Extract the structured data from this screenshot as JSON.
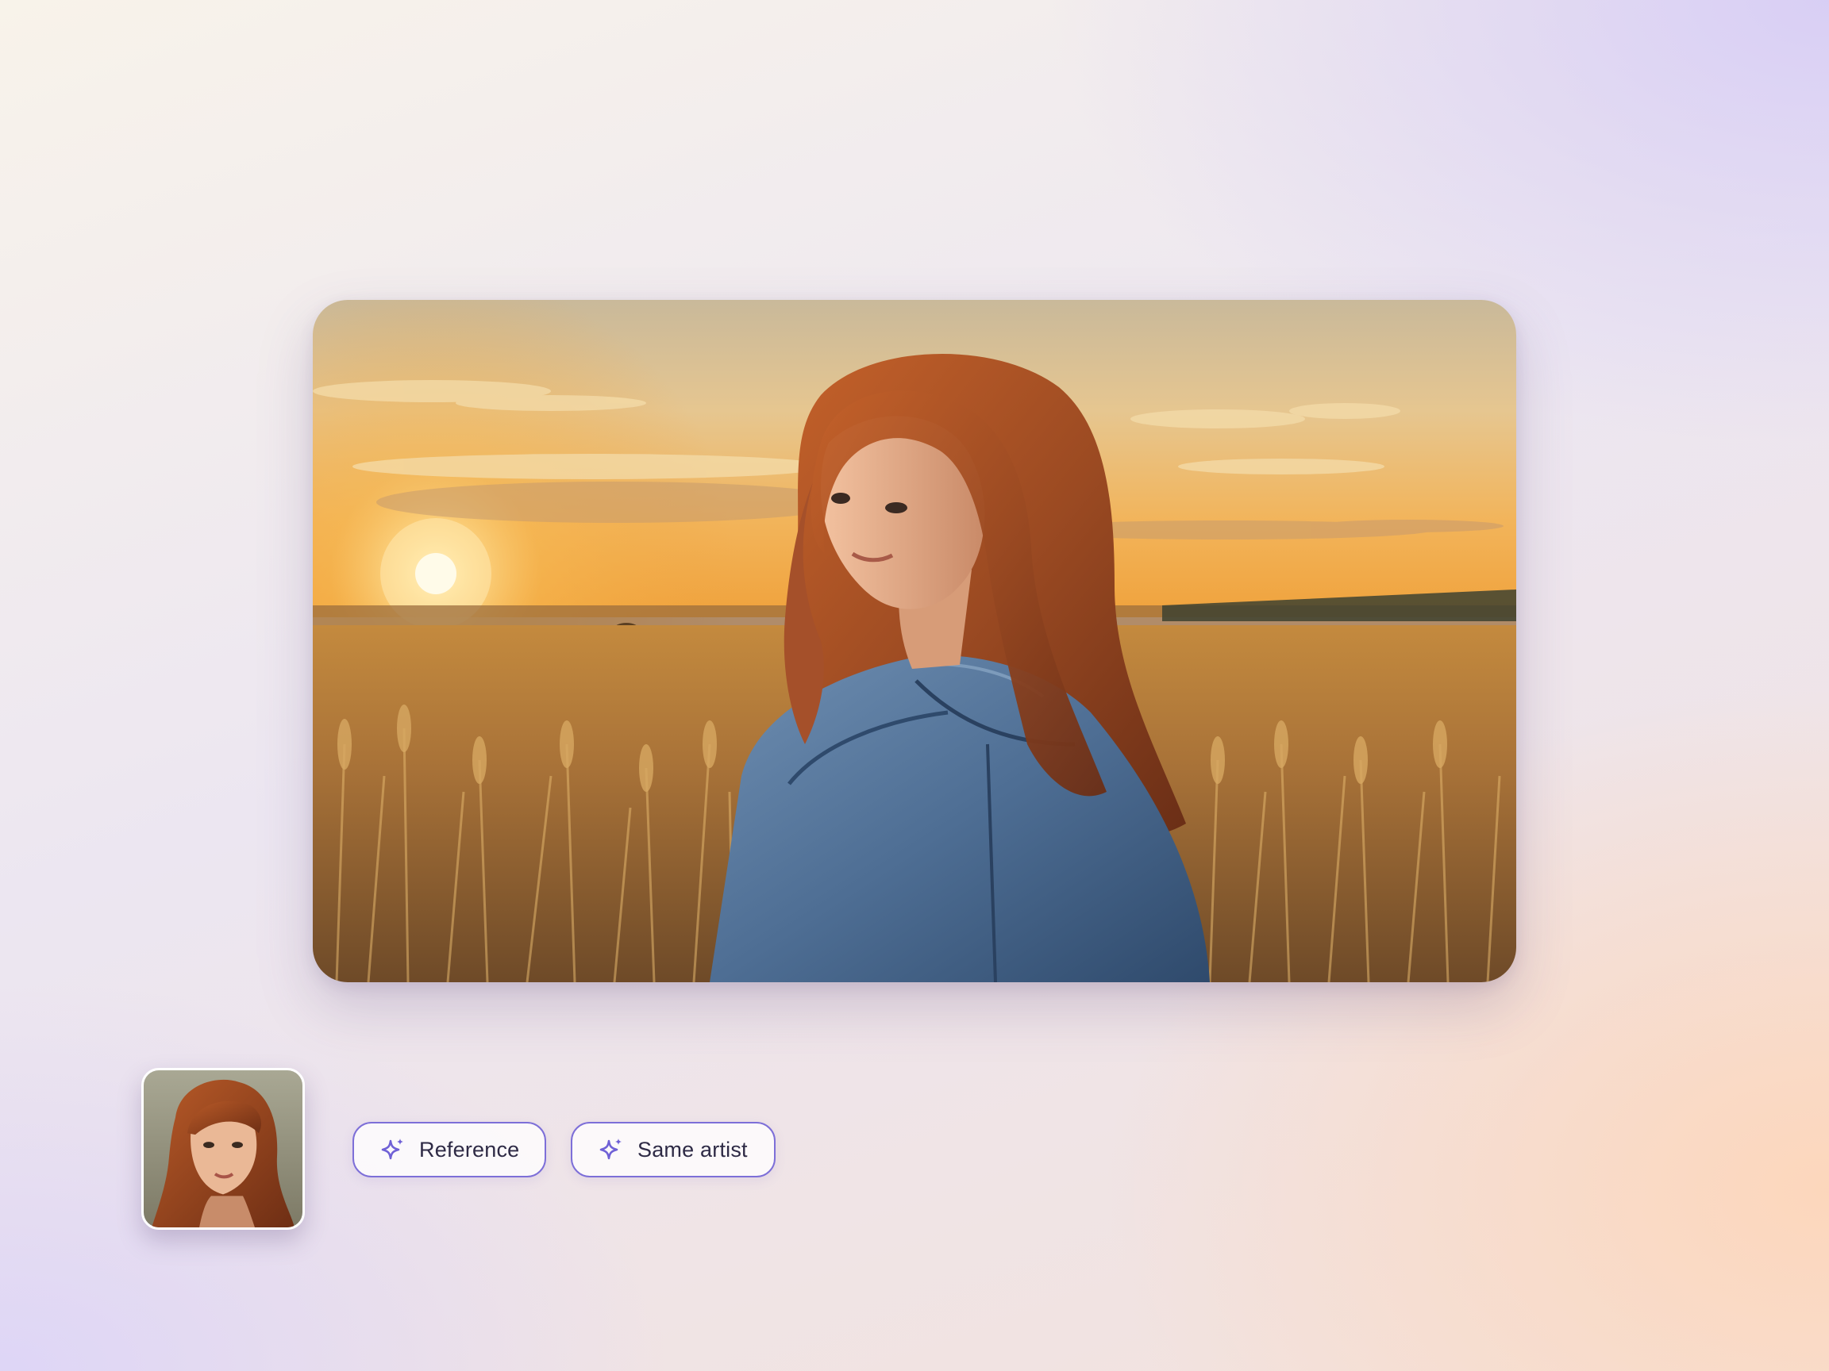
{
  "main_image": {
    "alt": "",
    "subject": "woman-in-wheat-field-at-sunset"
  },
  "reference_thumbnail": {
    "subject": "woman-portrait"
  },
  "chips": [
    {
      "label": "Reference",
      "icon": "sparkle-icon"
    },
    {
      "label": "Same artist",
      "icon": "sparkle-icon"
    }
  ],
  "colors": {
    "accent": "#7d6fd8",
    "chip_text": "#2e2a45"
  }
}
